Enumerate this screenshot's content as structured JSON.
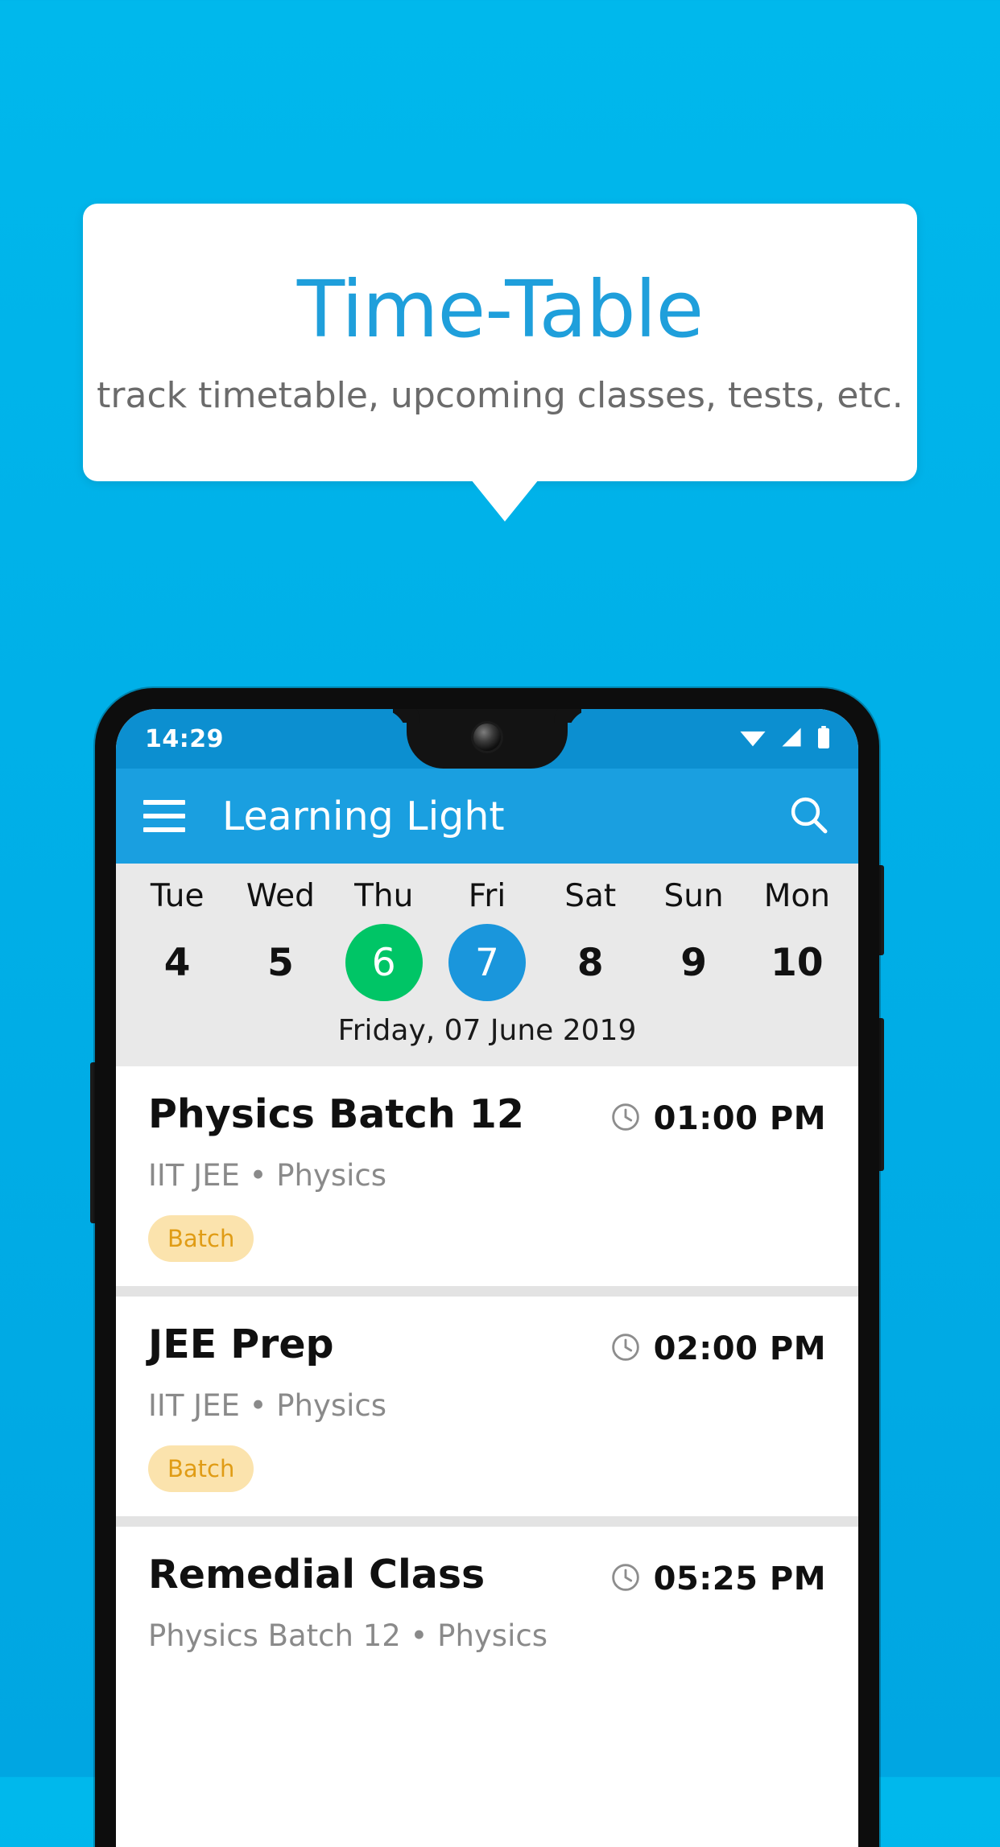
{
  "promo": {
    "title": "Time-Table",
    "subtitle": "track timetable, upcoming classes, tests, etc.",
    "bg_color": "#00b0e8",
    "title_color": "#1f9fdb"
  },
  "phone": {
    "status_bar": {
      "time": "14:29",
      "icons": [
        "wifi-icon",
        "signal-icon",
        "battery-icon"
      ]
    },
    "app_bar": {
      "menu_icon": "hamburger-icon",
      "title": "Learning Light",
      "search_icon": "search-icon",
      "color": "#1a9fe0"
    },
    "date_strip": {
      "days": [
        {
          "name": "Tue",
          "num": "4",
          "state": "normal"
        },
        {
          "name": "Wed",
          "num": "5",
          "state": "normal"
        },
        {
          "name": "Thu",
          "num": "6",
          "state": "today"
        },
        {
          "name": "Fri",
          "num": "7",
          "state": "selected"
        },
        {
          "name": "Sat",
          "num": "8",
          "state": "normal"
        },
        {
          "name": "Sun",
          "num": "9",
          "state": "normal"
        },
        {
          "name": "Mon",
          "num": "10",
          "state": "normal"
        }
      ],
      "today_color": "#00c566",
      "selected_color": "#1a96dc",
      "selected_date_label": "Friday, 07 June 2019"
    },
    "schedule": [
      {
        "title": "Physics Batch 12",
        "time": "01:00 PM",
        "time_icon": "clock-icon",
        "subtitle": "IIT JEE • Physics",
        "chip": "Batch"
      },
      {
        "title": "JEE Prep",
        "time": "02:00 PM",
        "time_icon": "clock-icon",
        "subtitle": "IIT JEE • Physics",
        "chip": "Batch"
      },
      {
        "title": "Remedial Class",
        "time": "05:25 PM",
        "time_icon": "clock-icon",
        "subtitle": "Physics Batch 12 • Physics",
        "chip": ""
      }
    ],
    "chip_bg": "#fbe3ad",
    "chip_text_color": "#e09c15"
  }
}
